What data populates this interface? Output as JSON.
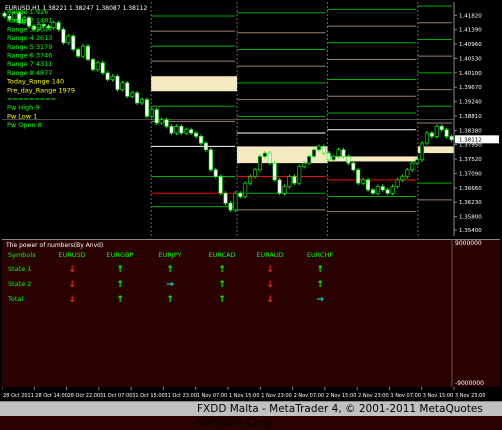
{
  "chart_info": "EURUSD,H1  1.38221 1.38247 1.38087 1.38112",
  "info_lines": [
    {
      "text": "Range 1   916",
      "color": "#00ff00"
    },
    {
      "text": "Range 2   1481",
      "color": "#00ff00"
    },
    {
      "text": "Range 3   2047",
      "color": "#00ff00"
    },
    {
      "text": "Range 4   2613",
      "color": "#00ff00"
    },
    {
      "text": "Range 5   3179",
      "color": "#00ff00"
    },
    {
      "text": "Range 6   3746",
      "color": "#00ff00"
    },
    {
      "text": "Range 7   4311",
      "color": "#00ff00"
    },
    {
      "text": "Range 8   4877",
      "color": "#00ff00"
    },
    {
      "text": "Today_Range   140",
      "color": "#ffff00"
    },
    {
      "text": "Pre_day_Range 1979",
      "color": "#ffff00"
    },
    {
      "text": "=========",
      "color": "#00ff00"
    },
    {
      "text": "Pw High   9",
      "color": "#00ff00"
    },
    {
      "text": "Pw Low    1",
      "color": "#ffff00"
    },
    {
      "text": "Pw Open   8",
      "color": "#00ff00"
    }
  ],
  "current_price": "1.38112",
  "indicator_title": "The power of numbers(By Anvd)",
  "indicator_scale_top": "9000000",
  "indicator_scale_bottom": "-9000000",
  "indicator_table": {
    "row_label_header": "Symbols",
    "symbols": [
      "EURUSD",
      "EURGBP",
      "EURJPY",
      "EURCAD",
      "EURAUD",
      "EURCHF"
    ],
    "rows": [
      {
        "label": "State 1",
        "arrows": [
          "down",
          "up",
          "up",
          "up",
          "down",
          "up"
        ]
      },
      {
        "label": "State 2",
        "arrows": [
          "down",
          "up",
          "right",
          "up",
          "down",
          "up"
        ]
      },
      {
        "label": "Total",
        "arrows": [
          "down",
          "up",
          "up",
          "up",
          "down",
          "right"
        ]
      }
    ]
  },
  "arrow_colors": {
    "up": "#00ff00",
    "down": "#ff2020",
    "right": "#00e0e0"
  },
  "footer": "FXDD Malta - MetaTrader 4, © 2001-2011 MetaQuotes Software Corp.",
  "chart_data": {
    "type": "candlestick",
    "symbol": "EURUSD",
    "timeframe": "H1",
    "y_ticks": [
      "1.41820",
      "1.41390",
      "1.40960",
      "1.40530",
      "1.40100",
      "1.39670",
      "1.39240",
      "1.38810",
      "1.38380",
      "1.37950",
      "1.37520",
      "1.37090",
      "1.36660",
      "1.36230",
      "1.35800",
      "1.35400"
    ],
    "ylim": [
      1.3522,
      1.4222
    ],
    "x_ticks": [
      "28 Oct 2011",
      "28 Oct 14:00",
      "28 Oct 22:00",
      "31 Oct 07:00",
      "31 Oct 15:00",
      "31 Oct 23:00",
      "1 Nov 07:00",
      "1 Nov 15:00",
      "1 Nov 23:00",
      "2 Nov 07:00",
      "2 Nov 15:00",
      "2 Nov 23:00",
      "3 Nov 07:00",
      "3 Nov 15:00",
      "3 Nov 23:00"
    ],
    "close": [
      1.418,
      1.417,
      1.419,
      1.416,
      1.4175,
      1.415,
      1.414,
      1.4155,
      1.415,
      1.4145,
      1.416,
      1.414,
      1.41,
      1.412,
      1.408,
      1.406,
      1.409,
      1.405,
      1.402,
      1.404,
      1.401,
      1.399,
      1.4,
      1.396,
      1.398,
      1.394,
      1.395,
      1.392,
      1.393,
      1.388,
      1.39,
      1.386,
      1.387,
      1.385,
      1.383,
      1.385,
      1.383,
      1.384,
      1.383,
      1.382,
      1.38,
      1.378,
      1.372,
      1.37,
      1.365,
      1.362,
      1.36,
      1.365,
      1.364,
      1.368,
      1.37,
      1.372,
      1.376,
      1.377,
      1.374,
      1.369,
      1.365,
      1.367,
      1.37,
      1.368,
      1.373,
      1.374,
      1.376,
      1.378,
      1.379,
      1.377,
      1.375,
      1.376,
      1.378,
      1.376,
      1.374,
      1.372,
      1.368,
      1.369,
      1.366,
      1.365,
      1.367,
      1.366,
      1.365,
      1.367,
      1.369,
      1.37,
      1.372,
      1.374,
      1.375,
      1.38,
      1.383,
      1.382,
      1.385,
      1.384,
      1.382,
      1.381
    ],
    "zones": [
      {
        "y_top": 1.4,
        "y_bottom": 1.3955,
        "x_start": 0.33,
        "x_end": 0.52,
        "fill": "#f5e9c0"
      },
      {
        "y_top": 1.379,
        "y_bottom": 1.374,
        "x_start": 0.52,
        "x_end": 0.72,
        "fill": "#f5e9c0"
      },
      {
        "y_top": 1.379,
        "y_bottom": 1.377,
        "x_start": 0.92,
        "x_end": 1.0,
        "fill": "#f5e9c0"
      },
      {
        "y_top": 1.376,
        "y_bottom": 1.3745,
        "x_start": 0.72,
        "x_end": 0.92,
        "fill": "#f5e9c0"
      }
    ],
    "level_lines": [
      {
        "y": 1.418,
        "x_start": 0.33,
        "x_end": 0.52,
        "color": "#00b000"
      },
      {
        "y": 1.4135,
        "x_start": 0.33,
        "x_end": 0.52,
        "color": "#a08070"
      },
      {
        "y": 1.409,
        "x_start": 0.33,
        "x_end": 0.52,
        "color": "#00b000"
      },
      {
        "y": 1.4045,
        "x_start": 0.33,
        "x_end": 0.52,
        "color": "#a08070"
      },
      {
        "y": 1.391,
        "x_start": 0.33,
        "x_end": 0.52,
        "color": "#00b000"
      },
      {
        "y": 1.3865,
        "x_start": 0.33,
        "x_end": 0.52,
        "color": "#a08070"
      },
      {
        "y": 1.379,
        "x_start": 0.33,
        "x_end": 0.52,
        "color": "#ffffff"
      },
      {
        "y": 1.37,
        "x_start": 0.33,
        "x_end": 0.52,
        "color": "#00b000"
      },
      {
        "y": 1.365,
        "x_start": 0.33,
        "x_end": 0.52,
        "color": "#ff0000"
      },
      {
        "y": 1.361,
        "x_start": 0.33,
        "x_end": 0.52,
        "color": "#00b000"
      },
      {
        "y": 1.419,
        "x_start": 0.52,
        "x_end": 0.72,
        "color": "#00b000"
      },
      {
        "y": 1.413,
        "x_start": 0.52,
        "x_end": 0.72,
        "color": "#a08070"
      },
      {
        "y": 1.408,
        "x_start": 0.52,
        "x_end": 0.72,
        "color": "#00b000"
      },
      {
        "y": 1.403,
        "x_start": 0.52,
        "x_end": 0.72,
        "color": "#a08070"
      },
      {
        "y": 1.398,
        "x_start": 0.52,
        "x_end": 0.72,
        "color": "#00b000"
      },
      {
        "y": 1.393,
        "x_start": 0.52,
        "x_end": 0.72,
        "color": "#a08070"
      },
      {
        "y": 1.388,
        "x_start": 0.52,
        "x_end": 0.72,
        "color": "#00b000"
      },
      {
        "y": 1.383,
        "x_start": 0.52,
        "x_end": 0.72,
        "color": "#ffffff"
      },
      {
        "y": 1.37,
        "x_start": 0.52,
        "x_end": 0.72,
        "color": "#ff0000"
      },
      {
        "y": 1.365,
        "x_start": 0.52,
        "x_end": 0.72,
        "color": "#00b000"
      },
      {
        "y": 1.36,
        "x_start": 0.52,
        "x_end": 0.72,
        "color": "#a08070"
      },
      {
        "y": 1.42,
        "x_start": 0.72,
        "x_end": 0.92,
        "color": "#00b000"
      },
      {
        "y": 1.415,
        "x_start": 0.72,
        "x_end": 0.92,
        "color": "#a08070"
      },
      {
        "y": 1.41,
        "x_start": 0.72,
        "x_end": 0.92,
        "color": "#00b000"
      },
      {
        "y": 1.405,
        "x_start": 0.72,
        "x_end": 0.92,
        "color": "#a08070"
      },
      {
        "y": 1.399,
        "x_start": 0.72,
        "x_end": 0.92,
        "color": "#00b000"
      },
      {
        "y": 1.394,
        "x_start": 0.72,
        "x_end": 0.92,
        "color": "#a08070"
      },
      {
        "y": 1.389,
        "x_start": 0.72,
        "x_end": 0.92,
        "color": "#00b000"
      },
      {
        "y": 1.384,
        "x_start": 0.72,
        "x_end": 0.92,
        "color": "#ffffff"
      },
      {
        "y": 1.369,
        "x_start": 0.72,
        "x_end": 0.92,
        "color": "#ff0000"
      },
      {
        "y": 1.364,
        "x_start": 0.72,
        "x_end": 0.92,
        "color": "#00b000"
      },
      {
        "y": 1.3595,
        "x_start": 0.72,
        "x_end": 0.92,
        "color": "#a08070"
      },
      {
        "y": 1.421,
        "x_start": 0.92,
        "x_end": 1.0,
        "color": "#00b000"
      },
      {
        "y": 1.416,
        "x_start": 0.92,
        "x_end": 1.0,
        "color": "#a08070"
      },
      {
        "y": 1.411,
        "x_start": 0.92,
        "x_end": 1.0,
        "color": "#00b000"
      },
      {
        "y": 1.406,
        "x_start": 0.92,
        "x_end": 1.0,
        "color": "#a08070"
      },
      {
        "y": 1.401,
        "x_start": 0.92,
        "x_end": 1.0,
        "color": "#00b000"
      },
      {
        "y": 1.396,
        "x_start": 0.92,
        "x_end": 1.0,
        "color": "#a08070"
      },
      {
        "y": 1.391,
        "x_start": 0.92,
        "x_end": 1.0,
        "color": "#00b000"
      },
      {
        "y": 1.386,
        "x_start": 0.92,
        "x_end": 1.0,
        "color": "#a08070"
      },
      {
        "y": 1.368,
        "x_start": 0.92,
        "x_end": 1.0,
        "color": "#00b000"
      },
      {
        "y": 1.363,
        "x_start": 0.92,
        "x_end": 1.0,
        "color": "#a08070"
      }
    ],
    "day_separators": [
      0.33,
      0.52,
      0.72,
      0.92
    ],
    "reference_line": 1.387
  }
}
